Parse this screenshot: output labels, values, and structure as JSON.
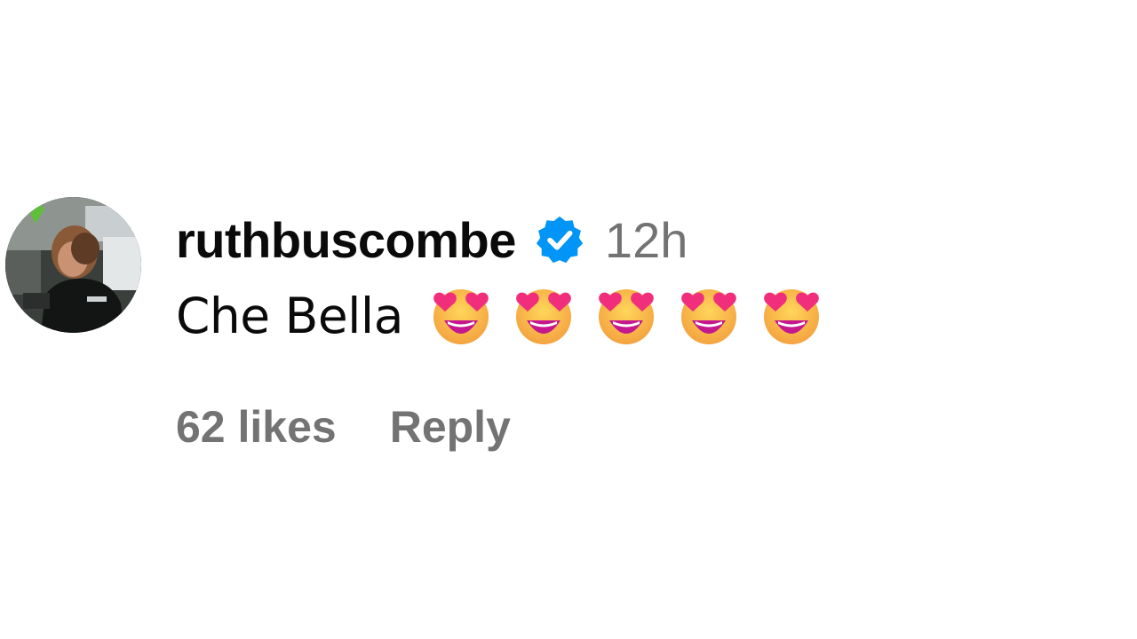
{
  "comment": {
    "avatar": {
      "icon": "profile-photo",
      "description_color": "#2a2d2b"
    },
    "username": "ruthbuscombe",
    "verified_icon": "verified-badge-icon",
    "verified_color": "#0095f6",
    "timestamp": "12h",
    "text": "Che Bella",
    "emojis": [
      "heart-eyes-emoji",
      "heart-eyes-emoji",
      "heart-eyes-emoji",
      "heart-eyes-emoji",
      "heart-eyes-emoji"
    ],
    "likes_label": "62 likes",
    "reply_label": "Reply"
  }
}
